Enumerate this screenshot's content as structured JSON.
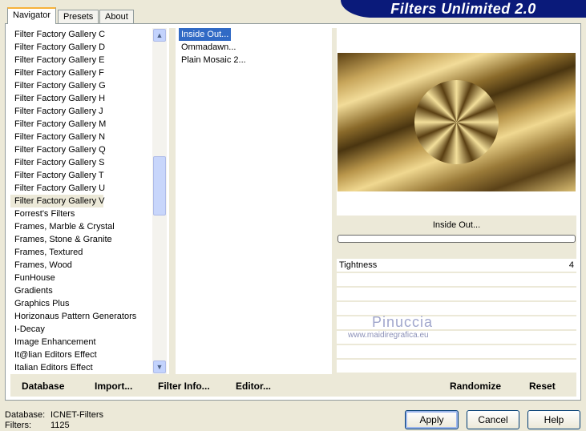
{
  "app": {
    "title": "Filters Unlimited 2.0"
  },
  "tabs": [
    {
      "label": "Navigator"
    },
    {
      "label": "Presets"
    },
    {
      "label": "About"
    }
  ],
  "categories": [
    "Filter Factory Gallery C",
    "Filter Factory Gallery D",
    "Filter Factory Gallery E",
    "Filter Factory Gallery F",
    "Filter Factory Gallery G",
    "Filter Factory Gallery H",
    "Filter Factory Gallery J",
    "Filter Factory Gallery M",
    "Filter Factory Gallery N",
    "Filter Factory Gallery Q",
    "Filter Factory Gallery S",
    "Filter Factory Gallery T",
    "Filter Factory Gallery U",
    "Filter Factory Gallery V",
    "Forrest's Filters",
    "Frames, Marble & Crystal",
    "Frames, Stone & Granite",
    "Frames, Textured",
    "Frames, Wood",
    "FunHouse",
    "Gradients",
    "Graphics Plus",
    "Horizonaus Pattern Generators",
    "I-Decay",
    "Image Enhancement",
    "It@lian Editors Effect",
    "Italian Editors Effect"
  ],
  "selected_category": "Filter Factory Gallery V",
  "filters": [
    "Inside Out...",
    "Ommadawn...",
    "Plain Mosaic 2..."
  ],
  "selected_filter": "Inside Out...",
  "preview": {
    "filter_name": "Inside Out...",
    "params": [
      {
        "name": "Tightness",
        "value": "4"
      }
    ]
  },
  "watermark": {
    "name": "Pinuccia",
    "url": "www.maidiregrafica.eu"
  },
  "buttons": {
    "database": "Database",
    "import": "Import...",
    "filter_info": "Filter Info...",
    "editor": "Editor...",
    "randomize": "Randomize",
    "reset": "Reset",
    "apply": "Apply",
    "cancel": "Cancel",
    "help": "Help"
  },
  "status": {
    "database_label": "Database:",
    "database_value": "ICNET-Filters",
    "filters_label": "Filters:",
    "filters_value": "1125"
  },
  "colors": {
    "banner": "#0a1a7a",
    "selection": "#316ac5",
    "face": "#ece9d8"
  }
}
